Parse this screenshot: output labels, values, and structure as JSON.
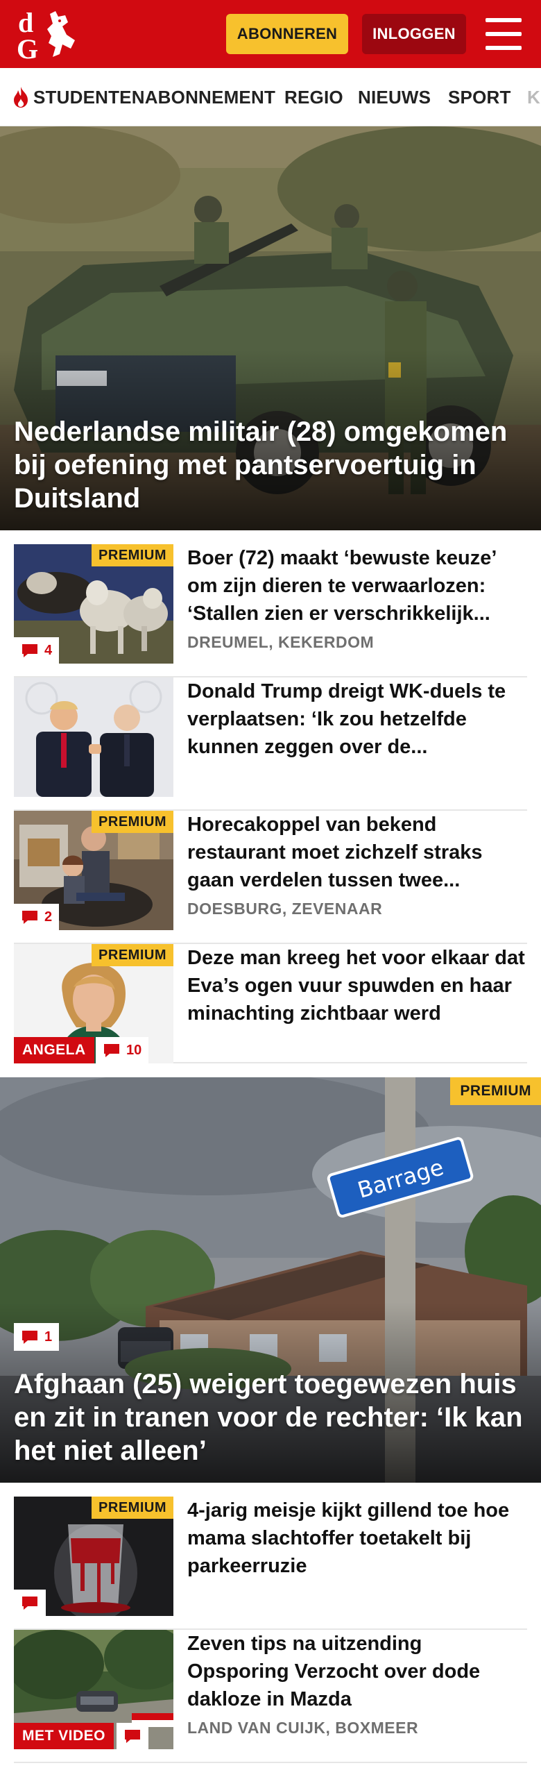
{
  "header": {
    "logo_letters": "dG",
    "subscribe_label": "ABONNEREN",
    "login_label": "INLOGGEN"
  },
  "nav": {
    "items": [
      "STUDENTENABONNEMENT",
      "REGIO",
      "NIEUWS",
      "SPORT",
      "K"
    ]
  },
  "hero1": {
    "title": "Nederlandse militair (28) omgekomen bij oefening met pantservoertuig in Duitsland"
  },
  "articles1": [
    {
      "title": "Boer (72) maakt ‘bewuste keuze’ om zijn dieren te verwaarlozen: ‘Stallen zien er verschrikkelijk...",
      "meta": "DREUMEL, KEKERDOM",
      "premium": "PREMIUM",
      "comments": "4"
    },
    {
      "title": "Donald Trump dreigt WK-duels te verplaatsen: ‘Ik zou hetzelfde kunnen zeggen over de..."
    },
    {
      "title": "Horecakoppel van bekend restaurant moet zichzelf straks gaan verdelen tussen twee...",
      "meta": "DOESBURG, ZEVENAAR",
      "premium": "PREMIUM",
      "comments": "2"
    },
    {
      "title": "Deze man kreeg het voor elkaar dat Eva’s ogen vuur spuwden en haar minachting zichtbaar werd",
      "premium": "PREMIUM",
      "label": "ANGELA",
      "comments": "10"
    }
  ],
  "hero2": {
    "title": "Afghaan (25) weigert toegewezen huis en zit in tranen voor de rechter: ‘Ik kan het niet alleen’",
    "premium": "PREMIUM",
    "comments": "1",
    "sign_text": "Barrage"
  },
  "articles2": [
    {
      "title": "4-jarig meisje kijkt gillend toe hoe mama slachtoffer toetakelt bij parkeerruzie",
      "premium": "PREMIUM"
    },
    {
      "title": "Zeven tips na uitzending Opsporing Verzocht over dode dakloze in Mazda",
      "meta": "LAND VAN CUIJK, BOXMEER",
      "label": "MET VIDEO"
    }
  ],
  "colors": {
    "brand_red": "#d10a11",
    "premium_yellow": "#f7c12d",
    "login_dark_red": "#9c0710"
  },
  "icons": [
    "logo-icon",
    "menu-icon",
    "flame-icon",
    "comment-icon"
  ]
}
